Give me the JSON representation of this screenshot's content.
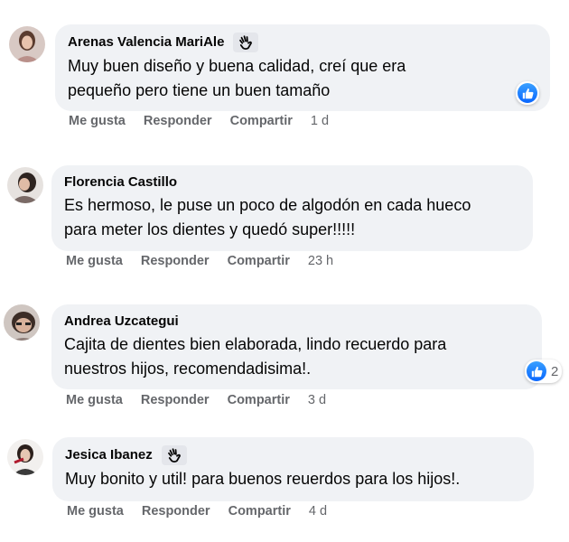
{
  "actions": {
    "like": "Me gusta",
    "reply": "Responder",
    "share": "Compartir"
  },
  "comments": [
    {
      "author": "Arenas Valencia MariAle",
      "badge": "wave-icon",
      "text_lines": [
        "Muy buen diseño y buena calidad, creí que era",
        "pequeño pero tiene un buen tamaño"
      ],
      "time": "1 d",
      "reaction": {
        "icon": "like-icon",
        "count": ""
      }
    },
    {
      "author": "Florencia Castillo",
      "badge": "",
      "text_lines": [
        "Es hermoso, le puse un poco de algodón en cada hueco",
        "para meter los dientes y quedó super!!!!!"
      ],
      "time": "23 h",
      "reaction": null
    },
    {
      "author": "Andrea Uzcategui",
      "badge": "",
      "text_lines": [
        "Cajita de dientes bien elaborada, lindo recuerdo para",
        "nuestros hijos, recomendadisima!."
      ],
      "time": "3 d",
      "reaction": {
        "icon": "like-icon",
        "count": "2"
      }
    },
    {
      "author": "Jesica Ibanez",
      "badge": "wave-icon",
      "text_lines": [
        "Muy bonito y util! para buenos reuerdos para los hijos!."
      ],
      "time": "4 d",
      "reaction": null
    }
  ],
  "colors": {
    "bubble": "#f0f2f5",
    "meta_text": "#65676b",
    "like_blue": "#0866ff"
  }
}
